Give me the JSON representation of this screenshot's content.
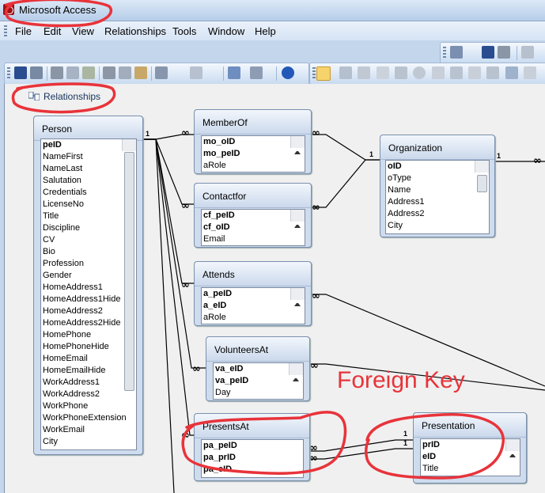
{
  "app": {
    "title": "Microsoft Access"
  },
  "menu": {
    "items": [
      "File",
      "Edit",
      "View",
      "Relationships",
      "Tools",
      "Window",
      "Help"
    ]
  },
  "document": {
    "tab_label": "Relationships"
  },
  "tables": {
    "person": {
      "title": "Person",
      "fields": [
        {
          "name": "peID",
          "key": true
        },
        {
          "name": "NameFirst"
        },
        {
          "name": "NameLast"
        },
        {
          "name": "Salutation"
        },
        {
          "name": "Credentials"
        },
        {
          "name": "LicenseNo"
        },
        {
          "name": "Title"
        },
        {
          "name": "Discipline"
        },
        {
          "name": "CV"
        },
        {
          "name": "Bio"
        },
        {
          "name": "Profession"
        },
        {
          "name": "Gender"
        },
        {
          "name": "HomeAddress1"
        },
        {
          "name": "HomeAddress1Hide"
        },
        {
          "name": "HomeAddress2"
        },
        {
          "name": "HomeAddress2Hide"
        },
        {
          "name": "HomePhone"
        },
        {
          "name": "HomePhoneHide"
        },
        {
          "name": "HomeEmail"
        },
        {
          "name": "HomeEmailHide"
        },
        {
          "name": "WorkAddress1"
        },
        {
          "name": "WorkAddress2"
        },
        {
          "name": "WorkPhone"
        },
        {
          "name": "WorkPhoneExtension"
        },
        {
          "name": "WorkEmail"
        },
        {
          "name": "City"
        }
      ]
    },
    "memberof": {
      "title": "MemberOf",
      "fields": [
        {
          "name": "mo_oID",
          "key": true
        },
        {
          "name": "mo_peID",
          "key": true
        },
        {
          "name": "aRole"
        }
      ]
    },
    "contactfor": {
      "title": "Contactfor",
      "fields": [
        {
          "name": "cf_peID",
          "key": true
        },
        {
          "name": "cf_oID",
          "key": true
        },
        {
          "name": "Email"
        }
      ]
    },
    "attends": {
      "title": "Attends",
      "fields": [
        {
          "name": "a_peID",
          "key": true
        },
        {
          "name": "a_eID",
          "key": true
        },
        {
          "name": "aRole"
        }
      ]
    },
    "volunteersat": {
      "title": "VolunteersAt",
      "fields": [
        {
          "name": "va_eID",
          "key": true
        },
        {
          "name": "va_peID",
          "key": true
        },
        {
          "name": "Day"
        }
      ]
    },
    "presentsat": {
      "title": "PresentsAt",
      "fields": [
        {
          "name": "pa_peID",
          "key": true
        },
        {
          "name": "pa_prID",
          "key": true
        },
        {
          "name": "pa_eID",
          "key": true
        }
      ]
    },
    "organization": {
      "title": "Organization",
      "fields": [
        {
          "name": "oID",
          "key": true
        },
        {
          "name": "oType"
        },
        {
          "name": "Name"
        },
        {
          "name": "Address1"
        },
        {
          "name": "Address2"
        },
        {
          "name": "City"
        }
      ]
    },
    "presentation": {
      "title": "Presentation",
      "fields": [
        {
          "name": "prID",
          "key": true
        },
        {
          "name": "eID",
          "key": true
        },
        {
          "name": "Title"
        }
      ]
    }
  },
  "relationship_labels": {
    "one": "1",
    "many": "∞"
  },
  "annotation": {
    "text": "Foreign Key",
    "color": "#e8333a"
  },
  "colors": {
    "annotation_red": "#e8333a",
    "line": "#000000"
  }
}
